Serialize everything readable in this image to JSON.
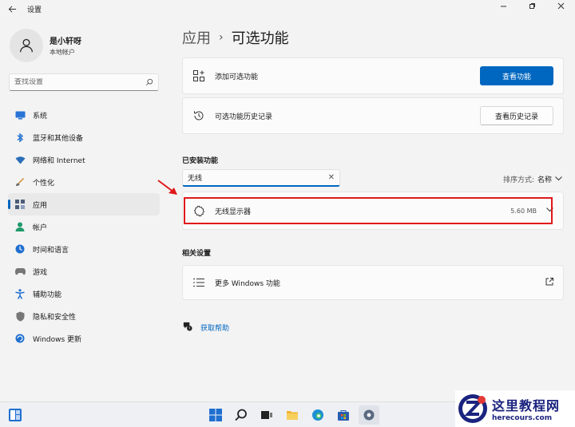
{
  "window": {
    "title": "设置",
    "back_icon": "back-arrow-icon",
    "controls": [
      "minimize-icon",
      "maximize-icon",
      "close-icon"
    ]
  },
  "profile": {
    "name": "是小轩呀",
    "account_type": "本地帐户"
  },
  "search": {
    "placeholder": "查找设置"
  },
  "sidebar": {
    "items": [
      {
        "label": "系统",
        "icon": "system-icon",
        "color": "#2a74d6"
      },
      {
        "label": "蓝牙和其他设备",
        "icon": "bluetooth-icon",
        "color": "#1f6fd0"
      },
      {
        "label": "网络和 Internet",
        "icon": "wifi-icon",
        "color": "#2a6fb8"
      },
      {
        "label": "个性化",
        "icon": "personalization-icon",
        "color": "#d08a2a"
      },
      {
        "label": "应用",
        "icon": "apps-icon",
        "color": "#4b5d78",
        "active": true
      },
      {
        "label": "帐户",
        "icon": "account-icon",
        "color": "#1f9a6b"
      },
      {
        "label": "时间和语言",
        "icon": "time-language-icon",
        "color": "#1f6fd0"
      },
      {
        "label": "游戏",
        "icon": "gaming-icon",
        "color": "#777777"
      },
      {
        "label": "辅助功能",
        "icon": "accessibility-icon",
        "color": "#1f6fd0"
      },
      {
        "label": "隐私和安全性",
        "icon": "shield-icon",
        "color": "#777777"
      },
      {
        "label": "Windows 更新",
        "icon": "update-icon",
        "color": "#1f6fd0"
      }
    ]
  },
  "main": {
    "breadcrumb_parent": "应用",
    "breadcrumb_separator": "›",
    "breadcrumb_current": "可选功能",
    "add_feature": {
      "label": "添加可选功能",
      "button": "查看功能",
      "icon": "add-feature-icon"
    },
    "history": {
      "label": "可选功能历史记录",
      "button": "查看历史记录",
      "icon": "history-icon"
    },
    "installed_title": "已安装功能",
    "filter_value": "无线",
    "clear_glyph": "✕",
    "sort_label": "排序方式:",
    "sort_value": "名称",
    "feature": {
      "name": "无线显示器",
      "size": "5.60 MB",
      "icon": "gear-outline-icon"
    },
    "related_title": "相关设置",
    "more_windows": {
      "label": "更多 Windows 功能",
      "icon": "list-icon",
      "link_icon": "open-external-icon"
    },
    "help": {
      "label": "获取帮助",
      "icon": "help-icon"
    }
  },
  "annotation": {
    "highlight_color": "#e0191a"
  },
  "taskbar": {
    "icons": [
      "start-icon",
      "search-icon",
      "task-view-icon",
      "file-explorer-icon",
      "edge-icon",
      "store-icon",
      "settings-icon"
    ]
  },
  "watermark": {
    "title": "这里教程网",
    "url": "herecours.com"
  }
}
